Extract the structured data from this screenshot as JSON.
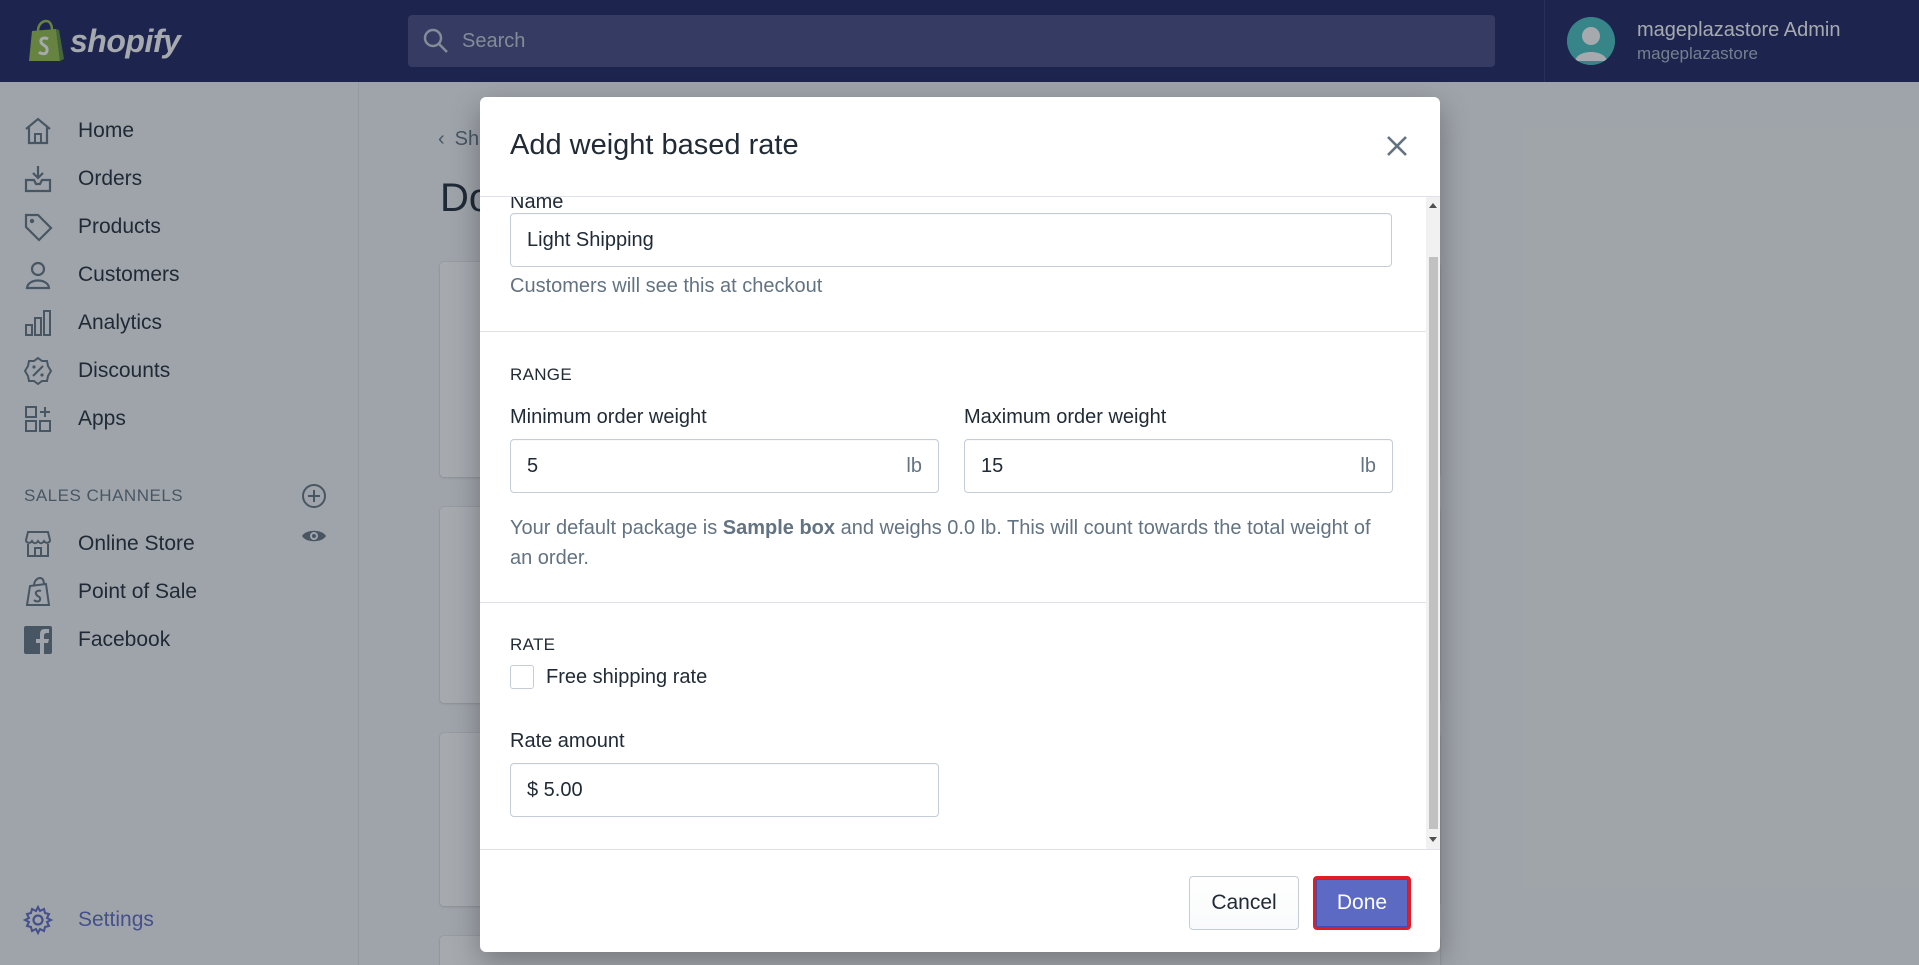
{
  "topbar": {
    "logo_text": "shopify",
    "search_placeholder": "Search",
    "user_name": "mageplazastore Admin",
    "user_store": "mageplazastore"
  },
  "sidebar": {
    "items": [
      {
        "label": "Home",
        "icon": "home-icon"
      },
      {
        "label": "Orders",
        "icon": "orders-icon"
      },
      {
        "label": "Products",
        "icon": "tag-icon"
      },
      {
        "label": "Customers",
        "icon": "person-icon"
      },
      {
        "label": "Analytics",
        "icon": "bar-chart-icon"
      },
      {
        "label": "Discounts",
        "icon": "discount-icon"
      },
      {
        "label": "Apps",
        "icon": "apps-icon"
      }
    ],
    "sales_channels_title": "SALES CHANNELS",
    "channels": [
      {
        "label": "Online Store",
        "icon": "store-icon"
      },
      {
        "label": "Point of Sale",
        "icon": "pos-icon"
      },
      {
        "label": "Facebook",
        "icon": "facebook-icon"
      }
    ],
    "settings_label": "Settings"
  },
  "background": {
    "breadcrumb": "Sh",
    "page_title": "Do"
  },
  "modal": {
    "title": "Add weight based rate",
    "name_label_partial": "Name",
    "name_value": "Light Shipping",
    "name_help": "Customers will see this at checkout",
    "range_title": "RANGE",
    "min_label": "Minimum order weight",
    "min_value": "5",
    "max_label": "Maximum order weight",
    "max_value": "15",
    "unit": "lb",
    "package_help_1": "Your default package is ",
    "package_name": "Sample box",
    "package_help_2": " and weighs 0.0 lb. This will count towards the total weight of an order.",
    "rate_title": "RATE",
    "free_shipping_label": "Free shipping rate",
    "free_shipping_checked": false,
    "rate_amount_label": "Rate amount",
    "rate_amount_value": "$ 5.00",
    "cancel_label": "Cancel",
    "done_label": "Done"
  },
  "colors": {
    "topbar": "#1c2260",
    "accent": "#5c6ac4",
    "highlight": "#e31b23"
  }
}
